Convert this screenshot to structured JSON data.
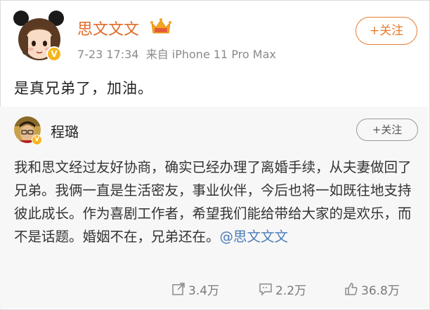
{
  "post": {
    "author": "思文文文",
    "time": "7-23 17:34",
    "source": "来自 iPhone 11 Pro Max",
    "follow_label": "+关注",
    "text": "是真兄弟了，加油。"
  },
  "repost": {
    "author": "程璐",
    "follow_label": "+关注",
    "text": "我和思文经过友好协商，确实已经办理了离婚手续，从夫妻做回了兄弟。我俩一直是生活密友，事业伙伴，今后也将一如既往地支持彼此成长。作为喜剧工作者，希望我们能给带给大家的是欢乐，而不是话题。婚姻不在，兄弟还在。",
    "mention": "@思文文文",
    "stats": {
      "reposts": "3.4万",
      "comments": "2.2万",
      "likes": "36.8万"
    }
  },
  "colors": {
    "author_orange": "#e06b27",
    "link_blue": "#4a7bb7",
    "verified_badge": "#f6b51d"
  },
  "icons": [
    "avatar-cartoon",
    "verified-badge-icon",
    "vip-crown-icon",
    "repost-icon",
    "comment-icon",
    "like-icon"
  ]
}
